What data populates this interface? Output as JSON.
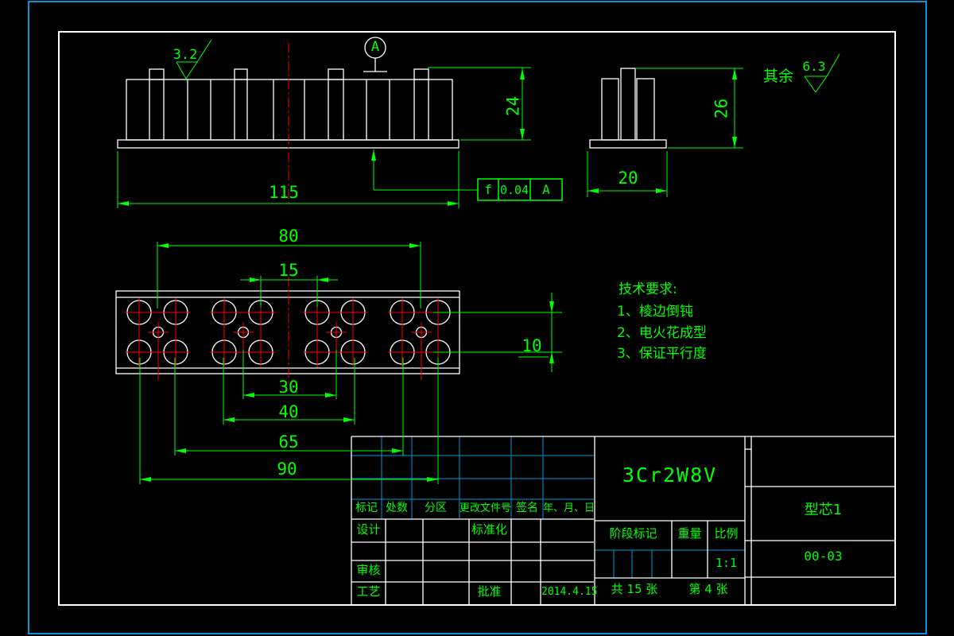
{
  "colors": {
    "geometry": "#ffffff",
    "dimension": "#00ff00",
    "centerline": "#ff0000",
    "table_grid": "#0098d8",
    "background": "#000000"
  },
  "surface_finish": {
    "top_value": "3.2",
    "rest_label": "其余",
    "rest_value": "6.3"
  },
  "datum": {
    "label": "A"
  },
  "fcf": {
    "symbol": "f",
    "tolerance": "0.04",
    "datum": "A"
  },
  "dims": {
    "total_width": "115",
    "width_80": "80",
    "width_15": "15",
    "height_24": "24",
    "side_height_26": "26",
    "side_width_20": "20",
    "row_gap_10": "10",
    "width_30": "30",
    "width_40": "40",
    "width_65": "65",
    "width_90": "90"
  },
  "tech_requirements": {
    "title": "技术要求:",
    "items": [
      "1、棱边倒钝",
      "2、电火花成型",
      "3、保证平行度"
    ]
  },
  "title_block": {
    "material": "3Cr2W8V",
    "part_name": "型芯1",
    "drawing_number": "00-03",
    "header": {
      "mark": "标记",
      "count": "处数",
      "zone": "分区",
      "change_file_no": "更改文件号",
      "signature": "签名",
      "date": "年、月、日"
    },
    "roles": {
      "design": "设计",
      "standardization": "标准化",
      "review": "审核",
      "process": "工艺",
      "approve": "批准"
    },
    "approve_date": "2014.4.15",
    "stage_mark": "阶段标记",
    "weight_label": "重量",
    "scale_label": "比例",
    "scale_value": "1:1",
    "sheet_total": "共 15 张",
    "sheet_number": "第 4 张"
  }
}
